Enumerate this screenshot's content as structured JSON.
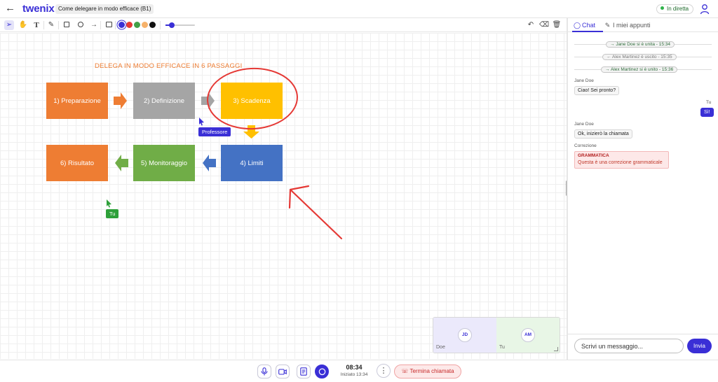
{
  "topbar": {
    "logo": "twenix",
    "doc_title": "Come delegare in modo efficace (B1)",
    "live_label": "In diretta"
  },
  "toolbar": {
    "tools": [
      "select-icon",
      "hand-icon",
      "text-icon",
      "pen-icon",
      "rectangle-icon",
      "circle-icon",
      "arrow-icon",
      "image-icon"
    ],
    "colors": [
      "#3a2fd6",
      "#e53935",
      "#43a047",
      "#f6b26b",
      "#111111"
    ],
    "selected_color": "#3a2fd6",
    "stroke_level": 0.2
  },
  "board": {
    "title": "DELEGA IN MODO EFFICACE IN 6 PASSAGGI",
    "steps": [
      {
        "label": "1) Preparazione",
        "color": "#ee7d33"
      },
      {
        "label": "2) Definizione",
        "color": "#a5a5a5"
      },
      {
        "label": "3) Scadenza",
        "color": "#ffc000"
      },
      {
        "label": "4) Limiti",
        "color": "#4472c4"
      },
      {
        "label": "5) Monitoraggio",
        "color": "#70ad47"
      },
      {
        "label": "6) Risultato",
        "color": "#ee7d33"
      }
    ],
    "cursors": [
      {
        "label": "Professore",
        "color": "#3a2fd6"
      },
      {
        "label": "Tu",
        "color": "#2da039"
      }
    ],
    "annotation_color": "#e53935"
  },
  "video": {
    "tiles": [
      {
        "initials": "JD",
        "name": "Doe",
        "bg": "#ebe9fb"
      },
      {
        "initials": "AM",
        "name": "Tu",
        "bg": "#e8f6e6"
      }
    ]
  },
  "chat": {
    "tabs": [
      {
        "label": "Chat",
        "icon": "chat-bubble-icon"
      },
      {
        "label": "I miei appunti",
        "icon": "notes-icon"
      }
    ],
    "events": [
      {
        "text": "Jane Doe si è unita - 15:34",
        "type": "join"
      },
      {
        "text": "Alex Martinez è uscito - 15:35",
        "type": "leave"
      },
      {
        "text": "Alex Martinez si è unito - 15:36",
        "type": "join"
      }
    ],
    "messages": [
      {
        "author": "Jane Doe",
        "text": "Ciao! Sei pronto?"
      },
      {
        "author": "Tu",
        "text": "Sì!"
      },
      {
        "author": "Jane Doe",
        "text": "Ok, inizierò la chiamata"
      }
    ],
    "correction": {
      "author": "Correzione",
      "title": "GRAMMATICA",
      "body": "Questa è una correzione grammaticale"
    },
    "input_placeholder": "Scrivi un messaggio...",
    "send_label": "Invia"
  },
  "controls": {
    "timer": "08:34",
    "started": "Iniziato 13:34",
    "end_call_label": "Termina chiamata"
  }
}
